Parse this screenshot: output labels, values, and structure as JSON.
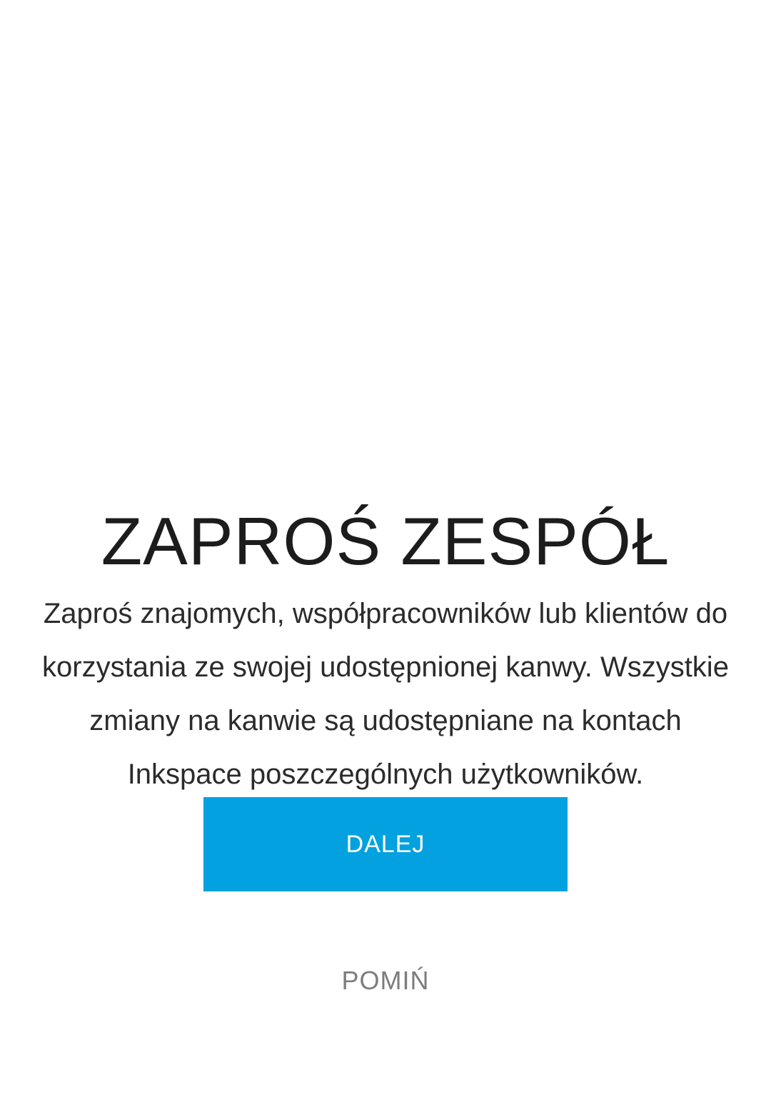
{
  "onboarding": {
    "title": "ZAPROŚ ZESPÓŁ",
    "description": "Zaproś znajomych, współpracowników lub klientów do korzystania ze swojej udostępnionej kanwy. Wszystkie zmiany na kanwie są udostępniane na kontach Inkspace poszczególnych użytkowników.",
    "next_label": "DALEJ",
    "skip_label": "POMIŃ"
  },
  "colors": {
    "accent": "#03a1e0",
    "title_text": "#1c1c1c",
    "body_text": "#2b2b2b",
    "skip_text": "#7d7d7d",
    "background": "#ffffff"
  }
}
